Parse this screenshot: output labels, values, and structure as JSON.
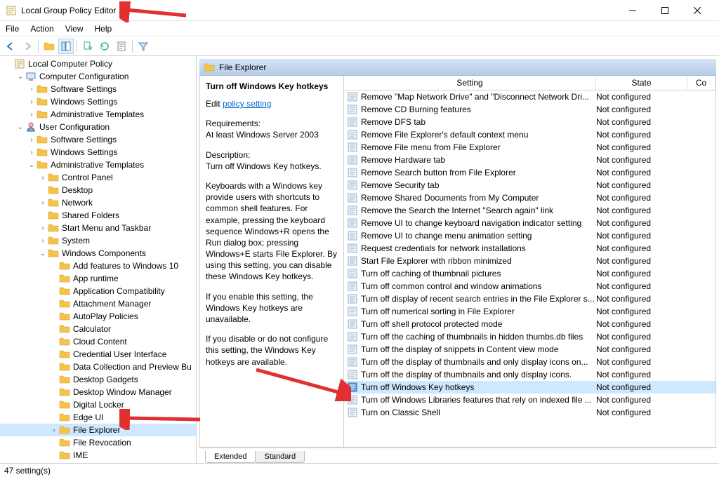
{
  "window": {
    "title": "Local Group Policy Editor"
  },
  "menu": [
    "File",
    "Action",
    "View",
    "Help"
  ],
  "tree": [
    {
      "d": 0,
      "exp": "",
      "icon": "gpo",
      "label": "Local Computer Policy"
    },
    {
      "d": 1,
      "exp": "v",
      "icon": "comp",
      "label": "Computer Configuration"
    },
    {
      "d": 2,
      "exp": ">",
      "icon": "folder",
      "label": "Software Settings"
    },
    {
      "d": 2,
      "exp": ">",
      "icon": "folder",
      "label": "Windows Settings"
    },
    {
      "d": 2,
      "exp": ">",
      "icon": "folder",
      "label": "Administrative Templates"
    },
    {
      "d": 1,
      "exp": "v",
      "icon": "user",
      "label": "User Configuration"
    },
    {
      "d": 2,
      "exp": ">",
      "icon": "folder",
      "label": "Software Settings"
    },
    {
      "d": 2,
      "exp": ">",
      "icon": "folder",
      "label": "Windows Settings"
    },
    {
      "d": 2,
      "exp": "v",
      "icon": "folder",
      "label": "Administrative Templates"
    },
    {
      "d": 3,
      "exp": ">",
      "icon": "folder",
      "label": "Control Panel"
    },
    {
      "d": 3,
      "exp": "",
      "icon": "folder",
      "label": "Desktop"
    },
    {
      "d": 3,
      "exp": ">",
      "icon": "folder",
      "label": "Network"
    },
    {
      "d": 3,
      "exp": "",
      "icon": "folder",
      "label": "Shared Folders"
    },
    {
      "d": 3,
      "exp": ">",
      "icon": "folder",
      "label": "Start Menu and Taskbar"
    },
    {
      "d": 3,
      "exp": ">",
      "icon": "folder",
      "label": "System"
    },
    {
      "d": 3,
      "exp": "v",
      "icon": "folder",
      "label": "Windows Components"
    },
    {
      "d": 4,
      "exp": "",
      "icon": "folder",
      "label": "Add features to Windows 10"
    },
    {
      "d": 4,
      "exp": "",
      "icon": "folder",
      "label": "App runtime"
    },
    {
      "d": 4,
      "exp": "",
      "icon": "folder",
      "label": "Application Compatibility"
    },
    {
      "d": 4,
      "exp": "",
      "icon": "folder",
      "label": "Attachment Manager"
    },
    {
      "d": 4,
      "exp": "",
      "icon": "folder",
      "label": "AutoPlay Policies"
    },
    {
      "d": 4,
      "exp": "",
      "icon": "folder",
      "label": "Calculator"
    },
    {
      "d": 4,
      "exp": "",
      "icon": "folder",
      "label": "Cloud Content"
    },
    {
      "d": 4,
      "exp": "",
      "icon": "folder",
      "label": "Credential User Interface"
    },
    {
      "d": 4,
      "exp": "",
      "icon": "folder",
      "label": "Data Collection and Preview Bu"
    },
    {
      "d": 4,
      "exp": "",
      "icon": "folder",
      "label": "Desktop Gadgets"
    },
    {
      "d": 4,
      "exp": "",
      "icon": "folder",
      "label": "Desktop Window Manager"
    },
    {
      "d": 4,
      "exp": "",
      "icon": "folder",
      "label": "Digital Locker"
    },
    {
      "d": 4,
      "exp": "",
      "icon": "folder",
      "label": "Edge UI"
    },
    {
      "d": 4,
      "exp": ">",
      "icon": "folder",
      "label": "File Explorer",
      "sel": true
    },
    {
      "d": 4,
      "exp": "",
      "icon": "folder",
      "label": "File Revocation"
    },
    {
      "d": 4,
      "exp": "",
      "icon": "folder",
      "label": "IME"
    }
  ],
  "content": {
    "header": "File Explorer",
    "desc": {
      "title": "Turn off Windows Key hotkeys",
      "edit_prefix": "Edit ",
      "edit_link": "policy setting ",
      "req_h": "Requirements:",
      "req": "At least Windows Server 2003",
      "desc_h": "Description:",
      "desc": "Turn off Windows Key hotkeys.",
      "p1": "Keyboards with a Windows key provide users with shortcuts to common shell features. For example, pressing the keyboard sequence Windows+R opens the Run dialog box; pressing Windows+E starts File Explorer. By using this setting, you can disable these Windows Key hotkeys.",
      "p2": "If you enable this setting, the Windows Key hotkeys are unavailable.",
      "p3": "If you disable or do not configure this setting, the Windows Key hotkeys are available."
    },
    "columns": {
      "setting": "Setting",
      "state": "State",
      "comment": "Co"
    },
    "rows": [
      {
        "name": "Remove \"Map Network Drive\" and \"Disconnect Network Dri...",
        "state": "Not configured"
      },
      {
        "name": "Remove CD Burning features",
        "state": "Not configured"
      },
      {
        "name": "Remove DFS tab",
        "state": "Not configured"
      },
      {
        "name": "Remove File Explorer's default context menu",
        "state": "Not configured"
      },
      {
        "name": "Remove File menu from File Explorer",
        "state": "Not configured"
      },
      {
        "name": "Remove Hardware tab",
        "state": "Not configured"
      },
      {
        "name": "Remove Search button from File Explorer",
        "state": "Not configured"
      },
      {
        "name": "Remove Security tab",
        "state": "Not configured"
      },
      {
        "name": "Remove Shared Documents from My Computer",
        "state": "Not configured"
      },
      {
        "name": "Remove the Search the Internet \"Search again\" link",
        "state": "Not configured"
      },
      {
        "name": "Remove UI to change keyboard navigation indicator setting",
        "state": "Not configured"
      },
      {
        "name": "Remove UI to change menu animation setting",
        "state": "Not configured"
      },
      {
        "name": "Request credentials for network installations",
        "state": "Not configured"
      },
      {
        "name": "Start File Explorer with ribbon minimized",
        "state": "Not configured"
      },
      {
        "name": "Turn off caching of thumbnail pictures",
        "state": "Not configured"
      },
      {
        "name": "Turn off common control and window animations",
        "state": "Not configured"
      },
      {
        "name": "Turn off display of recent search entries in the File Explorer s...",
        "state": "Not configured"
      },
      {
        "name": "Turn off numerical sorting in File Explorer",
        "state": "Not configured"
      },
      {
        "name": "Turn off shell protocol protected mode",
        "state": "Not configured"
      },
      {
        "name": "Turn off the caching of thumbnails in hidden thumbs.db files",
        "state": "Not configured"
      },
      {
        "name": "Turn off the display of snippets in Content view mode",
        "state": "Not configured"
      },
      {
        "name": "Turn off the display of thumbnails and only display icons on...",
        "state": "Not configured"
      },
      {
        "name": "Turn off the display of thumbnails and only display icons.",
        "state": "Not configured"
      },
      {
        "name": "Turn off Windows Key hotkeys",
        "state": "Not configured",
        "sel": true
      },
      {
        "name": "Turn off Windows Libraries features that rely on indexed file ...",
        "state": "Not configured"
      },
      {
        "name": "Turn on Classic Shell",
        "state": "Not configured"
      }
    ],
    "tabs": [
      "Extended",
      "Standard"
    ]
  },
  "status": "47 setting(s)"
}
